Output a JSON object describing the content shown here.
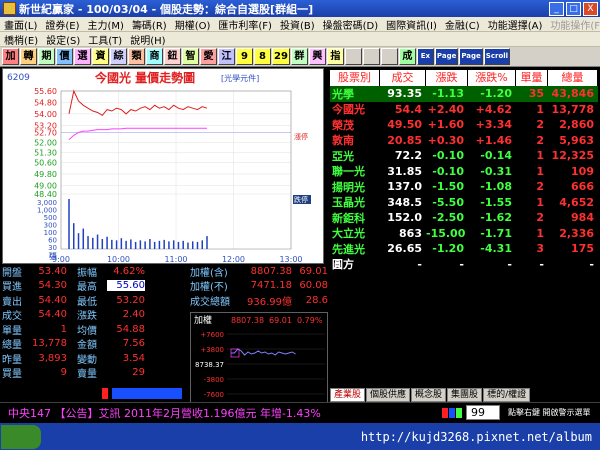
{
  "window": {
    "title": "新世紀贏家 - 100/03/04 - 個股走勢：綜合自選股[群組一]",
    "min_label": "_",
    "max_label": "□",
    "close_label": "X"
  },
  "menu1": [
    "畫面(L)",
    "證券(E)",
    "主力(M)",
    "籌碼(R)",
    "期權(O)",
    "匯市利率(F)",
    "投資(B)",
    "操盤密碼(D)",
    "國際資訊(I)",
    "金融(C)",
    "功能選擇(A)",
    "功能操作(F)"
  ],
  "menu2": [
    "橋梢(E)",
    "設定(S)",
    "工具(T)",
    "說明(H)"
  ],
  "toolbar": [
    "加",
    "轉",
    "期",
    "價",
    "選",
    "資",
    "綜",
    "類",
    "商",
    "鈕",
    "智",
    "愛",
    "江",
    "9",
    "8",
    "29",
    "群",
    "興",
    "指",
    "",
    "",
    "",
    "成",
    "Ex",
    "Page",
    "Page",
    "Scroll"
  ],
  "chart": {
    "code": "6209",
    "title": "今國光  量價走勢圖",
    "tag": "[光學元件]",
    "limit_up_label": "漲停",
    "limit_down_label": "跌停",
    "vol_label": "張",
    "time_labels": [
      "9:00",
      "10:00",
      "11:00",
      "12:00",
      "13:00"
    ]
  },
  "chart_data": {
    "type": "line",
    "title": "今國光  量價走勢圖",
    "xlabel": "",
    "ylabel": "",
    "price_ticks": [
      55.6,
      54.8,
      54.0,
      53.2,
      52.7,
      52.0,
      51.3,
      50.6,
      49.8,
      49.0,
      48.4
    ],
    "volume_ticks": [
      3000,
      1000,
      500,
      300,
      100,
      60,
      30,
      15
    ],
    "price_series": [
      54.0,
      55.6,
      54.9,
      54.6,
      54.4,
      54.2,
      54.1,
      53.9,
      54.3,
      54.2,
      54.4,
      54.3,
      54.0,
      54.3,
      54.2,
      54.4,
      54.5,
      54.3,
      54.6,
      54.4,
      54.5,
      54.3,
      54.6,
      54.4,
      54.3,
      54.5,
      54.4,
      54.3,
      54.5,
      54.4
    ],
    "avg_series": [
      52.2,
      52.5,
      52.7,
      52.8,
      52.8,
      52.85,
      52.9,
      52.9,
      52.9,
      52.95,
      52.95,
      52.95,
      53.0,
      53.0,
      53.0,
      53.0,
      53.0,
      53.0,
      53.0,
      53.0,
      53.0,
      53.0,
      53.0,
      53.0,
      53.0,
      53.0,
      53.0,
      53.0,
      53.0,
      53.0
    ],
    "volume_series": [
      3000,
      800,
      300,
      500,
      200,
      150,
      250,
      120,
      180,
      100,
      90,
      140,
      80,
      110,
      60,
      90,
      70,
      120,
      60,
      80,
      100,
      70,
      90,
      60,
      80,
      50,
      70,
      60,
      90,
      200
    ],
    "ylim": [
      48.4,
      55.6
    ]
  },
  "quote": {
    "rows": [
      {
        "l1": "開盤",
        "v1": "53.40",
        "l2": "振幅",
        "v2": "4.62%"
      },
      {
        "l1": "買進",
        "v1": "54.30",
        "l2": "最高",
        "v2": "55.60"
      },
      {
        "l1": "賣出",
        "v1": "54.40",
        "l2": "最低",
        "v2": "53.20"
      },
      {
        "l1": "成交",
        "v1": "54.40",
        "l2": "漲跌",
        "v2": "2.40"
      },
      {
        "l1": "單量",
        "v1": "1",
        "l2": "均價",
        "v2": "54.88"
      },
      {
        "l1": "總量",
        "v1": "13,778",
        "l2": "金額",
        "v2": "7.56"
      },
      {
        "l1": "昨量",
        "v1": "3,893",
        "l2": "變動",
        "v2": "3.54"
      },
      {
        "l1": "買量",
        "v1": "9",
        "l2": "賣量",
        "v2": "29"
      }
    ]
  },
  "quote2": {
    "rows": [
      {
        "l": "加權(含)",
        "v1": "8807.38",
        "v2": "69.01"
      },
      {
        "l": "加權(不)",
        "v1": "7471.18",
        "v2": "60.08"
      },
      {
        "l": "成交總額",
        "v1": "936.99億",
        "v2": "28.6"
      }
    ]
  },
  "mini": {
    "label": "加權",
    "index": "8807.38",
    "change": "69.01",
    "pct": "0.79%",
    "ticks": [
      "+7600",
      "+3800",
      "8738.37",
      "-3800",
      "-7600"
    ]
  },
  "table": {
    "headers": [
      "股票別",
      "成交",
      "漲跌",
      "漲跌%",
      "單量",
      "總量"
    ],
    "rows": [
      {
        "name": "光學",
        "price": "93.35",
        "chg": "-1.13",
        "pct": "-1.20",
        "vol": "35",
        "total": "43,846",
        "nc": "green",
        "pc": "white",
        "cc": "green",
        "vc": "red"
      },
      {
        "name": "今國光",
        "price": "54.4",
        "chg": "+2.40",
        "pct": "+4.62",
        "vol": "1",
        "total": "13,778",
        "nc": "red",
        "pc": "red",
        "cc": "red",
        "vc": "red"
      },
      {
        "name": "榮茂",
        "price": "49.50",
        "chg": "+1.60",
        "pct": "+3.34",
        "vol": "2",
        "total": "2,860",
        "nc": "red",
        "pc": "red",
        "cc": "red",
        "vc": "red"
      },
      {
        "name": "敦南",
        "price": "20.85",
        "chg": "+0.30",
        "pct": "+1.46",
        "vol": "2",
        "total": "5,963",
        "nc": "red",
        "pc": "red",
        "cc": "red",
        "vc": "red"
      },
      {
        "name": "亞光",
        "price": "72.2",
        "chg": "-0.10",
        "pct": "-0.14",
        "vol": "1",
        "total": "12,325",
        "nc": "green",
        "pc": "white",
        "cc": "green",
        "vc": "red"
      },
      {
        "name": "聯一光",
        "price": "31.85",
        "chg": "-0.10",
        "pct": "-0.31",
        "vol": "1",
        "total": "109",
        "nc": "green",
        "pc": "white",
        "cc": "green",
        "vc": "red"
      },
      {
        "name": "揚明光",
        "price": "137.0",
        "chg": "-1.50",
        "pct": "-1.08",
        "vol": "2",
        "total": "666",
        "nc": "green",
        "pc": "white",
        "cc": "green",
        "vc": "red"
      },
      {
        "name": "玉晶光",
        "price": "348.5",
        "chg": "-5.50",
        "pct": "-1.55",
        "vol": "1",
        "total": "4,652",
        "nc": "green",
        "pc": "white",
        "cc": "green",
        "vc": "red"
      },
      {
        "name": "新鉅科",
        "price": "152.0",
        "chg": "-2.50",
        "pct": "-1.62",
        "vol": "2",
        "total": "984",
        "nc": "green",
        "pc": "white",
        "cc": "green",
        "vc": "red"
      },
      {
        "name": "大立光",
        "price": "863",
        "chg": "-15.00",
        "pct": "-1.71",
        "vol": "1",
        "total": "2,336",
        "nc": "green",
        "pc": "white",
        "cc": "green",
        "vc": "red"
      },
      {
        "name": "先進光",
        "price": "26.65",
        "chg": "-1.20",
        "pct": "-4.31",
        "vol": "3",
        "total": "175",
        "nc": "green",
        "pc": "white",
        "cc": "green",
        "vc": "red"
      },
      {
        "name": "圓方",
        "price": "-",
        "chg": "-",
        "pct": "-",
        "vol": "-",
        "total": "-",
        "nc": "white",
        "pc": "white",
        "cc": "white",
        "vc": "white"
      }
    ]
  },
  "tabs": [
    "產業股",
    "個股供應",
    "概念股",
    "集團股",
    "標的/權證"
  ],
  "ticker": {
    "message": "中央147 【公告】艾訊 2011年2月營收1.196億元 年增-1.43%",
    "index_value": "99",
    "hint": "點擊右鍵 開啟警示選單"
  },
  "statusbar": {
    "watermark": "http://kujd3268.pixnet.net/album"
  },
  "colors": {
    "up": "#ff3030",
    "down": "#40ff40",
    "label": "#80c8ff",
    "header_bg": "#ffffff"
  }
}
